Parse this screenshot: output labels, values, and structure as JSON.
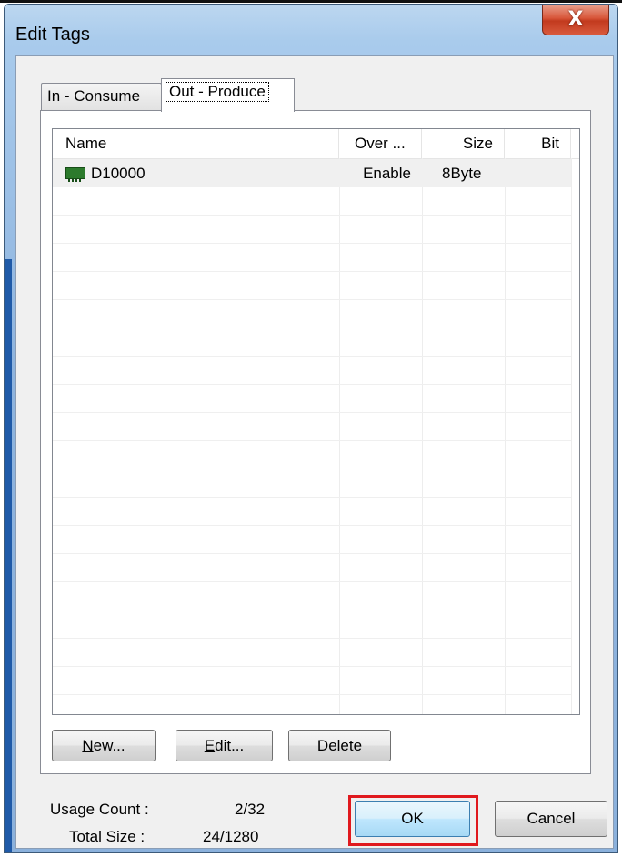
{
  "window": {
    "title": "Edit Tags",
    "close_symbol": "X"
  },
  "tabs": [
    {
      "label": "In - Consume",
      "active": false
    },
    {
      "label": "Out - Produce",
      "active": true
    }
  ],
  "list": {
    "columns": [
      "Name",
      "Over ...",
      "Size",
      "Bit"
    ],
    "rows": [
      {
        "icon": "memory-chip-icon",
        "name": "D10000",
        "over": "Enable",
        "size": "8Byte",
        "bit": ""
      }
    ]
  },
  "buttons": {
    "new_prefix": "",
    "new_mnemonic": "N",
    "new_rest": "ew...",
    "edit_mnemonic": "E",
    "edit_rest": "dit...",
    "delete": "Delete",
    "ok": "OK",
    "cancel": "Cancel"
  },
  "stats": {
    "usage_label": "Usage Count :",
    "usage_value": "2/32",
    "total_label": "Total Size :",
    "total_value": "24/1280"
  },
  "colors": {
    "highlight": "#e0191e",
    "close_button": "#c23a1e"
  }
}
